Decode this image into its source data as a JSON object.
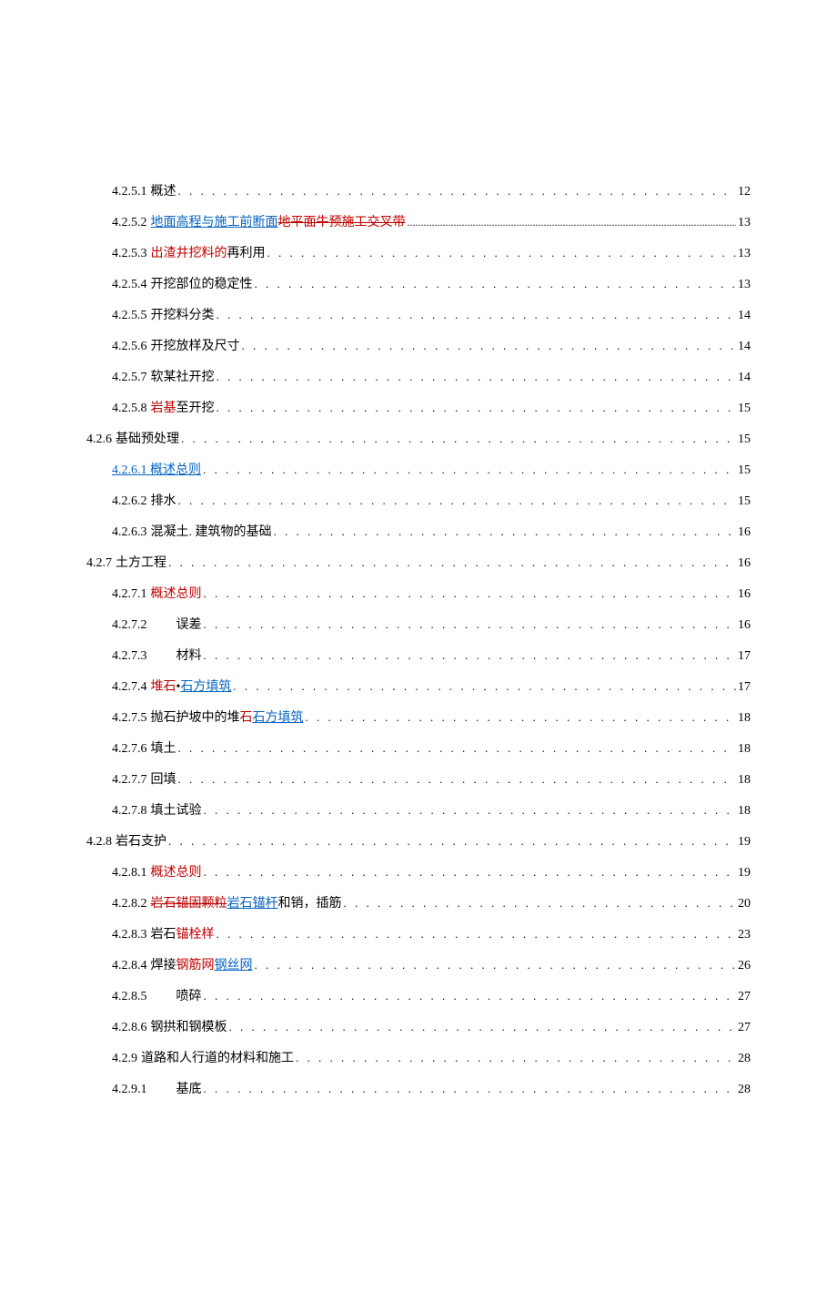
{
  "toc": [
    {
      "indent": 2,
      "num": "4.2.5.1",
      "segments": [
        {
          "text": "概述"
        }
      ],
      "page": "12"
    },
    {
      "indent": 2,
      "num": "4.2.5.2",
      "segments": [
        {
          "text": "地面高程与施工前断面",
          "cls": "link"
        },
        {
          "text": "地平面牛预施工交叉带",
          "cls": "red-strike"
        }
      ],
      "page": "13",
      "dotted": false
    },
    {
      "indent": 2,
      "num": "4.2.5.3",
      "segments": [
        {
          "text": "出渣井挖料的",
          "cls": "red"
        },
        {
          "text": "再利用"
        }
      ],
      "page": "13"
    },
    {
      "indent": 2,
      "num": "4.2.5.4",
      "segments": [
        {
          "text": "开挖部位的稳定性"
        }
      ],
      "page": "13"
    },
    {
      "indent": 2,
      "num": "4.2.5.5",
      "segments": [
        {
          "text": "开挖料分类"
        }
      ],
      "page": "14"
    },
    {
      "indent": 2,
      "num": "4.2.5.6",
      "segments": [
        {
          "text": "开挖放样及尺寸"
        }
      ],
      "page": "14"
    },
    {
      "indent": 2,
      "num": "4.2.5.7",
      "segments": [
        {
          "text": "软某社开挖"
        }
      ],
      "page": "14"
    },
    {
      "indent": 2,
      "num": "4.2.5.8",
      "segments": [
        {
          "text": "岩基",
          "cls": "red"
        },
        {
          "text": "至开挖"
        }
      ],
      "page": "15"
    },
    {
      "indent": 1,
      "num": "4.2.6",
      "segments": [
        {
          "text": "基础预处理 "
        }
      ],
      "page": "15"
    },
    {
      "indent": 2,
      "num": "",
      "segments": [
        {
          "text": "4.2.6.1 概述总则",
          "cls": "link"
        }
      ],
      "page": "15"
    },
    {
      "indent": 2,
      "num": "4.2.6.2",
      "segments": [
        {
          "text": "排水"
        }
      ],
      "page": "15"
    },
    {
      "indent": 2,
      "num": "4.2.6.3",
      "segments": [
        {
          "text": "混凝土. 建筑物的基础"
        }
      ],
      "page": "16"
    },
    {
      "indent": 1,
      "num": "4.2.7",
      "segments": [
        {
          "text": "土方工程 "
        }
      ],
      "page": "16"
    },
    {
      "indent": 2,
      "num": "4.2.7.1",
      "segments": [
        {
          "text": "概述总则",
          "cls": "red"
        }
      ],
      "page": "16"
    },
    {
      "indent": 2,
      "num": "4.2.7.2",
      "tab": true,
      "segments": [
        {
          "text": "误差 "
        }
      ],
      "page": "16"
    },
    {
      "indent": 2,
      "num": "4.2.7.3",
      "tab": true,
      "segments": [
        {
          "text": "材料 "
        }
      ],
      "page": "17"
    },
    {
      "indent": 2,
      "num": "4.2.7.4",
      "segments": [
        {
          "text": "堆石",
          "cls": "red"
        },
        {
          "text": "•"
        },
        {
          "text": "石方填筑",
          "cls": "link"
        }
      ],
      "page": "17"
    },
    {
      "indent": 2,
      "num": "4.2.7.5",
      "segments": [
        {
          "text": "抛石护坡中的堆"
        },
        {
          "text": "石",
          "cls": "red"
        },
        {
          "text": "石方填筑",
          "cls": "link"
        },
        {
          "text": " "
        }
      ],
      "page": "18"
    },
    {
      "indent": 2,
      "num": "4.2.7.6",
      "segments": [
        {
          "text": "填土"
        }
      ],
      "page": "18"
    },
    {
      "indent": 2,
      "num": "4.2.7.7",
      "segments": [
        {
          "text": "回填"
        }
      ],
      "page": "18"
    },
    {
      "indent": 2,
      "num": "4.2.7.8",
      "segments": [
        {
          "text": "填土试验"
        }
      ],
      "page": "18"
    },
    {
      "indent": 1,
      "num": "4.2.8",
      "segments": [
        {
          "text": "岩石支护 "
        }
      ],
      "page": "19"
    },
    {
      "indent": 2,
      "num": "4.2.8.1",
      "segments": [
        {
          "text": "概述总则",
          "cls": "red"
        }
      ],
      "page": "19"
    },
    {
      "indent": 2,
      "num": "4.2.8.2",
      "segments": [
        {
          "text": "岩石锚固颗粒",
          "cls": "red-strike"
        },
        {
          "text": "岩石锚杆",
          "cls": "link"
        },
        {
          "text": "和销，插筋 "
        }
      ],
      "page": "20"
    },
    {
      "indent": 2,
      "num": "4.2.8.3",
      "segments": [
        {
          "text": "岩石"
        },
        {
          "text": "锚栓样",
          "cls": "red"
        }
      ],
      "page": "23"
    },
    {
      "indent": 2,
      "num": "4.2.8.4",
      "segments": [
        {
          "text": "焊接"
        },
        {
          "text": "钢筋网",
          "cls": "red"
        },
        {
          "text": "钢丝网",
          "cls": "link"
        }
      ],
      "page": "26"
    },
    {
      "indent": 2,
      "num": "4.2.8.5",
      "tab": true,
      "segments": [
        {
          "text": "喷碎 "
        }
      ],
      "page": "27"
    },
    {
      "indent": 2,
      "num": "4.2.8.6",
      "segments": [
        {
          "text": "钢拱和钢模板"
        }
      ],
      "page": "27"
    },
    {
      "indent": 2,
      "num": "4.2.9",
      "segments": [
        {
          "text": "道路和人行道的材料和施工 "
        }
      ],
      "page": "28"
    },
    {
      "indent": 2,
      "num": "4.2.9.1",
      "tab": true,
      "segments": [
        {
          "text": "基底"
        }
      ],
      "page": "28"
    }
  ],
  "dotSeq": ". . . . . . . . . . . . . . . . . . . . . . . . . . . . . . . . . . . . . . . . . . . . . . . . . . . . . . . . . . . . . . . . . . . . . . . . . . . . . . . . . . . . . . . . . . . . . . . . . . . . . . . . . . . . . . . . . . . . . . . . . . . . . . . . . . . . . . . . . . . . . . . . . . . . . . .",
  "dashSeq": "................................................................................................................................................................................................................."
}
